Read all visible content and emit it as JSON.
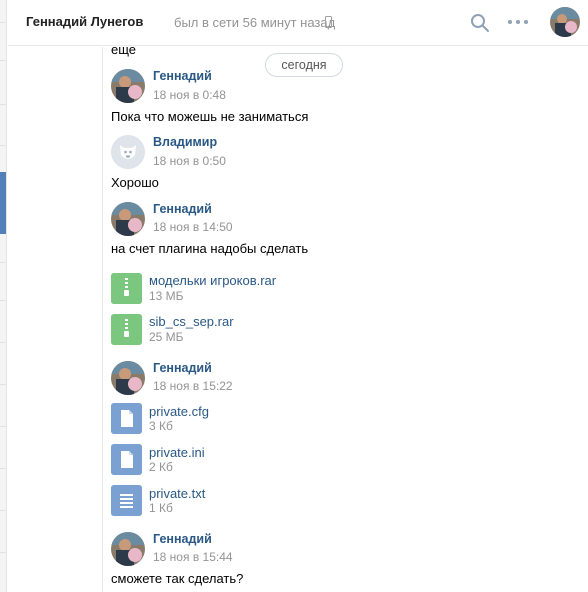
{
  "header": {
    "name": "Геннадий Лунегов",
    "status": "был в сети 56 минут назад"
  },
  "chat": {
    "top_fragment": "еще",
    "date_divider": "сегодня",
    "messages": [
      {
        "author": "Геннадий",
        "time": "18 ноя в 0:48",
        "text": "Пока что можешь не заниматься"
      },
      {
        "author": "Владимир",
        "time": "18 ноя в 0:50",
        "text": "Хорошо"
      },
      {
        "author": "Геннадий",
        "time": "18 ноя в 14:50",
        "text": "на счет плагина надобы сделать",
        "files": [
          {
            "name": "модельки игроков.rar",
            "size": "13 МБ",
            "kind": "archive"
          },
          {
            "name": "sib_cs_sep.rar",
            "size": "25 МБ",
            "kind": "archive"
          }
        ]
      },
      {
        "author": "Геннадий",
        "time": "18 ноя в 15:22",
        "files": [
          {
            "name": "private.cfg",
            "size": "3 Кб",
            "kind": "file"
          },
          {
            "name": "private.ini",
            "size": "2 Кб",
            "kind": "file"
          },
          {
            "name": "private.txt",
            "size": "1 Кб",
            "kind": "text"
          }
        ]
      },
      {
        "author": "Геннадий",
        "time": "18 ноя в 15:44",
        "text": "сможете так сделать?"
      }
    ]
  },
  "colors": {
    "link": "#2a5885",
    "muted": "#939393",
    "archive_icon": "#7bc77f",
    "doc_icon": "#7ba1d3",
    "accent": "#5181b8"
  },
  "icons": [
    "phone-icon",
    "search-icon",
    "more-icon",
    "archive-icon",
    "document-icon",
    "text-document-icon",
    "dog-avatar-icon"
  ]
}
